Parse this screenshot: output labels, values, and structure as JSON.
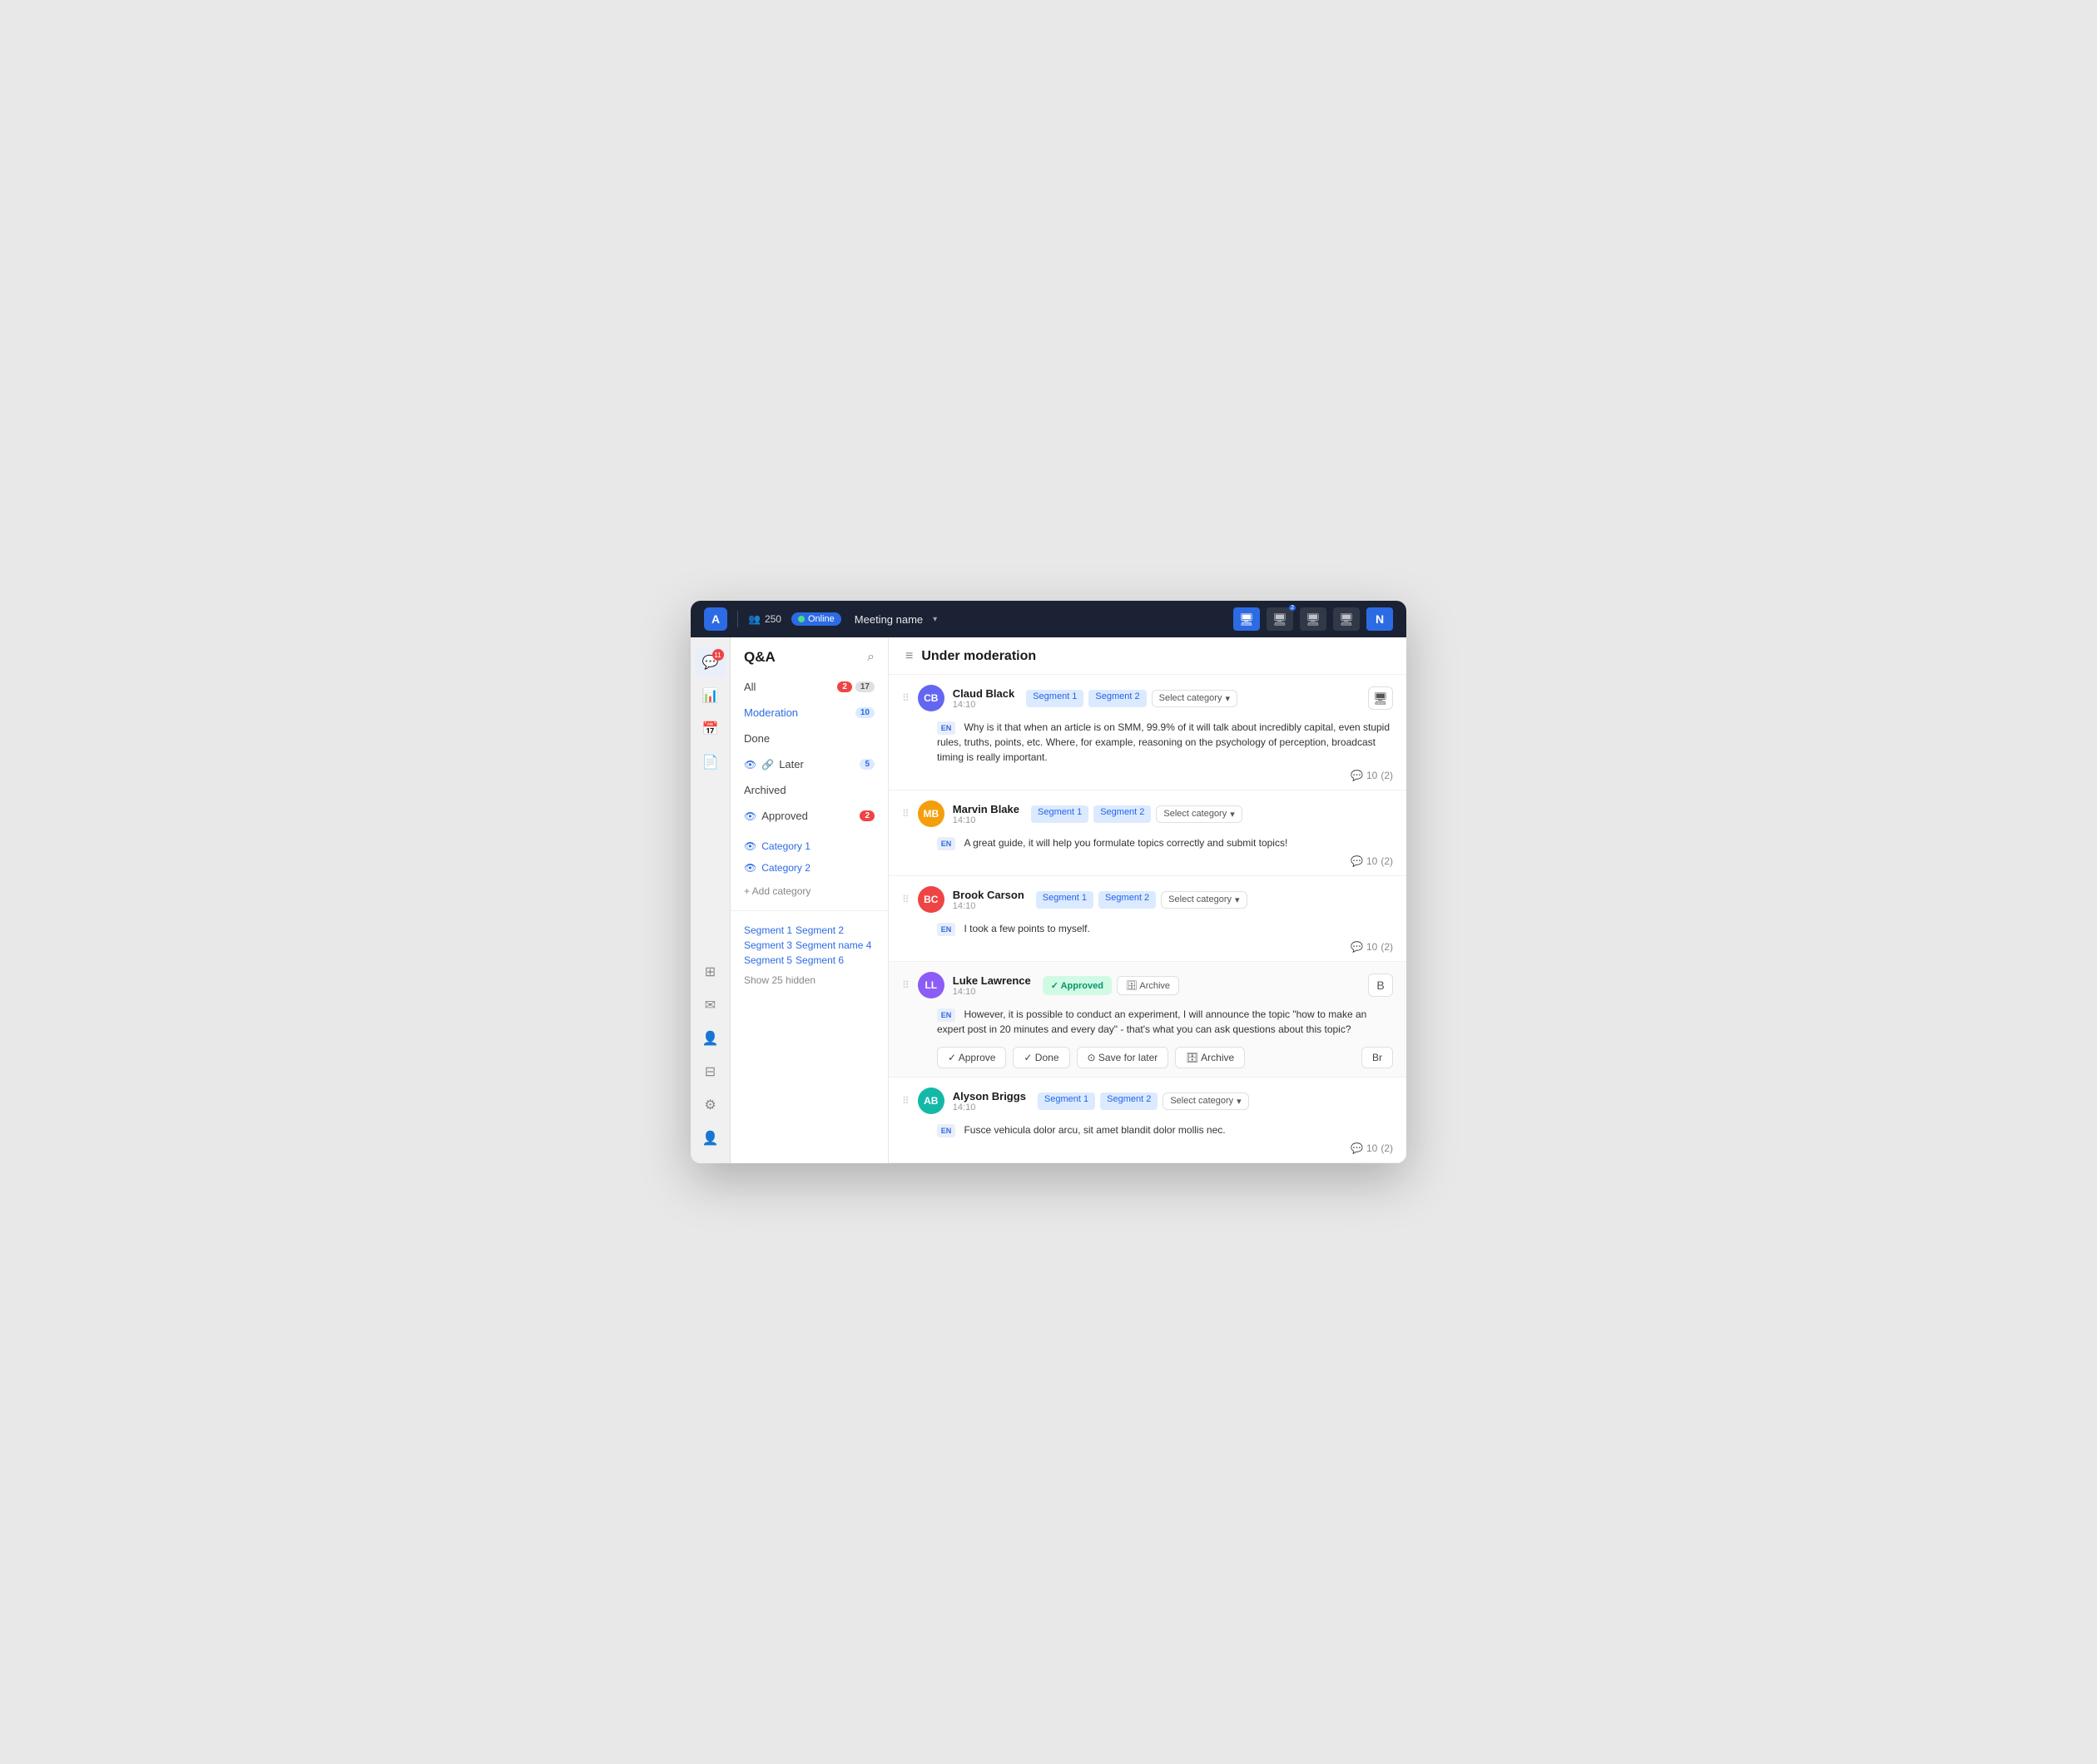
{
  "app": {
    "logo": "A",
    "attendees": "250",
    "online_label": "Online",
    "meeting_name": "Meeting name",
    "topbar_icons": [
      "🖥",
      "🖥",
      "🖥",
      "🖥"
    ]
  },
  "sidebar": {
    "badge": "11"
  },
  "left_panel": {
    "title": "Q&A",
    "nav_items": [
      {
        "label": "All",
        "badge_red": "2",
        "badge_gray": "17",
        "active": false
      },
      {
        "label": "Moderation",
        "badge_blue": "10",
        "active": true
      },
      {
        "label": "Done",
        "active": false
      },
      {
        "label": "Later",
        "badge_blue": "5",
        "active": false
      },
      {
        "label": "Archived",
        "active": false
      },
      {
        "label": "Approved",
        "badge_red": "2",
        "active": false
      }
    ],
    "categories": [
      {
        "label": "Category 1"
      },
      {
        "label": "Category 2"
      }
    ],
    "add_category": "+ Add category",
    "segments": [
      "Segment 1",
      "Segment 2",
      "Segment 3",
      "Segment name 4",
      "Segment 5",
      "Segment 6"
    ],
    "show_hidden": "Show 25 hidden"
  },
  "right_panel": {
    "title": "Under moderation",
    "questions": [
      {
        "id": 1,
        "user": "Claud Black",
        "time": "14:10",
        "avatar_initials": "CB",
        "avatar_class": "avatar-cb",
        "tags": [
          "Segment 1",
          "Segment 2"
        ],
        "select_category": "Select category",
        "lang": "EN",
        "text": "Why is it that when an article is on SMM, 99.9% of it will talk about incredibly capital, even stupid rules, truths, points, etc. Where, for example, reasoning on the psychology of perception, broadcast timing is really important.",
        "votes": "10",
        "comments": "(2)",
        "has_action_buttons": false,
        "has_approved_row": false
      },
      {
        "id": 2,
        "user": "Marvin Blake",
        "time": "14:10",
        "avatar_initials": "MB",
        "avatar_class": "avatar-mb",
        "tags": [
          "Segment 1",
          "Segment 2"
        ],
        "select_category": "Select category",
        "lang": "EN",
        "text": "A great guide, it will help you formulate topics correctly and submit topics!",
        "votes": "10",
        "comments": "(2)",
        "has_action_buttons": false,
        "has_approved_row": false
      },
      {
        "id": 3,
        "user": "Brook Carson",
        "time": "14:10",
        "avatar_initials": "BC",
        "avatar_class": "avatar-bc",
        "tags": [
          "Segment 1",
          "Segment 2"
        ],
        "select_category": "Select category",
        "lang": "EN",
        "text": "I took a few points to myself.",
        "votes": "10",
        "comments": "(2)",
        "has_action_buttons": false,
        "has_approved_row": false
      },
      {
        "id": 4,
        "user": "Luke Lawrence",
        "time": "14:10",
        "avatar_initials": "LL",
        "avatar_class": "avatar-ll",
        "tags": [],
        "select_category": "",
        "lang": "EN",
        "text": "However, it is possible to conduct an experiment, I will announce the topic \"how to make an expert post in 20 minutes and every day\" - that's what you can ask questions about this topic?",
        "votes": "10",
        "comments": "(2)",
        "has_action_buttons": true,
        "has_approved_row": true,
        "approved_label": "✓ Approved",
        "archive_label": "🗄 Archive",
        "action_buttons": [
          "✓ Approve",
          "✓ Done",
          "⊙ Save for later",
          "🗄 Archive"
        ]
      },
      {
        "id": 5,
        "user": "Alyson Briggs",
        "time": "14:10",
        "avatar_initials": "AB",
        "avatar_class": "avatar-ab",
        "tags": [
          "Segment 1",
          "Segment 2"
        ],
        "select_category": "Select category",
        "lang": "EN",
        "text": "Fusce vehicula dolor arcu, sit amet blandit dolor mollis nec.",
        "votes": "10",
        "comments": "(2)",
        "has_action_buttons": false,
        "has_approved_row": false
      }
    ]
  },
  "icons": {
    "menu": "≡",
    "search": "⌕",
    "drag": "⠿",
    "chevron_down": "▾",
    "comment": "💬",
    "check": "✓",
    "archive": "🗄",
    "save": "⊙",
    "eye": "👁",
    "monitor": "🖥",
    "shield": "🛡",
    "grid": "⊞",
    "mail": "✉",
    "person": "👤",
    "chart": "📊",
    "calendar": "📅",
    "file": "📄",
    "settings": "⚙"
  }
}
